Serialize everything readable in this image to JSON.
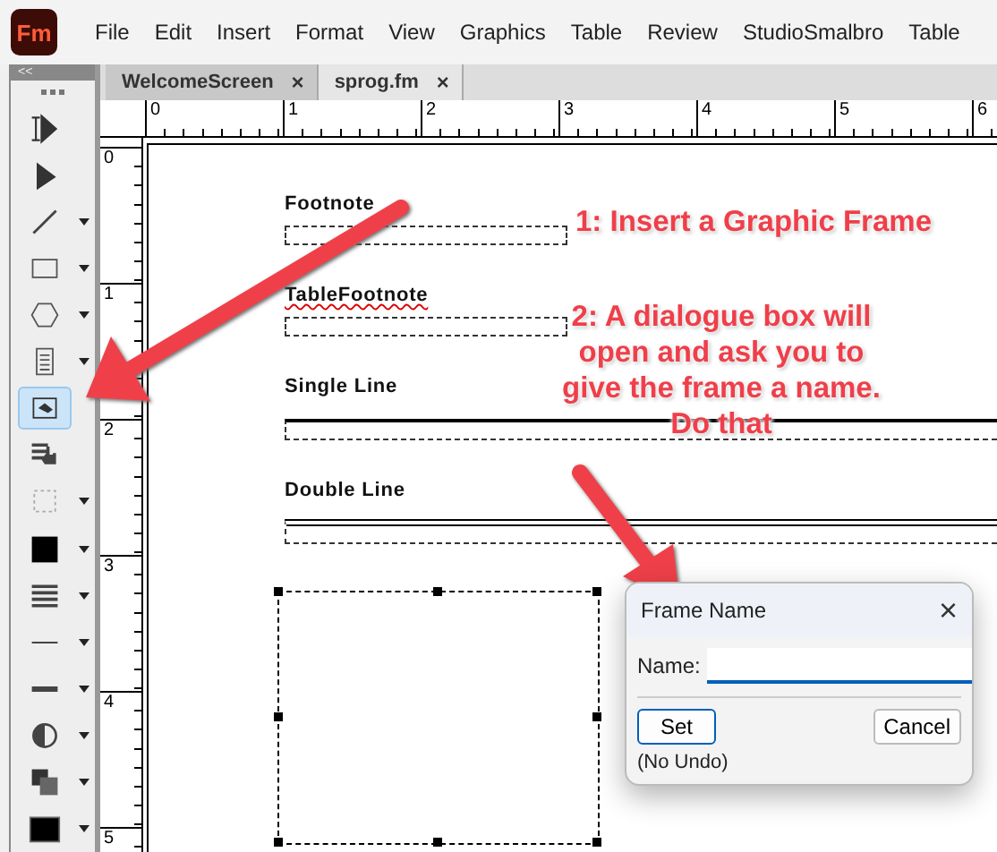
{
  "app": {
    "logo": "Fm"
  },
  "menu": [
    "File",
    "Edit",
    "Insert",
    "Format",
    "View",
    "Graphics",
    "Table",
    "Review",
    "StudioSmalbro",
    "Table"
  ],
  "toolbar": {
    "collapse": "<<",
    "tools": [
      {
        "kind": "text-select",
        "selected": false,
        "dropdown": false
      },
      {
        "kind": "pointer",
        "selected": false,
        "dropdown": false
      },
      {
        "kind": "line",
        "selected": false,
        "dropdown": true
      },
      {
        "kind": "rectangle",
        "selected": false,
        "dropdown": true
      },
      {
        "kind": "polygon",
        "selected": false,
        "dropdown": true
      },
      {
        "kind": "text-frame",
        "selected": false,
        "dropdown": true
      },
      {
        "kind": "graphic-frame",
        "selected": true,
        "dropdown": false
      },
      {
        "kind": "hand",
        "selected": false,
        "dropdown": false
      },
      {
        "kind": "dotted-rect",
        "selected": false,
        "dropdown": true
      },
      {
        "kind": "fill",
        "selected": false,
        "dropdown": true
      },
      {
        "kind": "line-widths",
        "selected": false,
        "dropdown": true
      },
      {
        "kind": "thin-line",
        "selected": false,
        "dropdown": true
      },
      {
        "kind": "thick-line",
        "selected": false,
        "dropdown": true
      },
      {
        "kind": "tint",
        "selected": false,
        "dropdown": true
      },
      {
        "kind": "overlap",
        "selected": false,
        "dropdown": true
      },
      {
        "kind": "color",
        "selected": false,
        "dropdown": true
      }
    ]
  },
  "tabs": [
    {
      "label": "WelcomeScreen",
      "close": "×",
      "selected": false
    },
    {
      "label": "sprog.fm",
      "close": "×",
      "selected": true
    }
  ],
  "ruler": {
    "horizontal": [
      "0",
      "1",
      "2",
      "3",
      "4",
      "5",
      "6"
    ],
    "vertical": [
      "0",
      "1",
      "2",
      "3",
      "4",
      "5"
    ]
  },
  "document": {
    "paragraphs": [
      {
        "label": "Footnote",
        "kind": "short",
        "misspelled": false
      },
      {
        "label": "TableFootnote",
        "kind": "short",
        "misspelled": true
      },
      {
        "label": "Single Line",
        "kind": "single",
        "misspelled": false
      },
      {
        "label": "Double Line",
        "kind": "double",
        "misspelled": false
      }
    ],
    "graphic_frame": {
      "selected": true
    }
  },
  "annotations": [
    "1: Insert a Graphic Frame",
    "2: A dialogue box will open and ask you to give the frame a name. Do that"
  ],
  "dialog": {
    "title": "Frame Name",
    "close": "×",
    "name_label": "Name:",
    "buttons": [
      {
        "label": "Set",
        "default": true
      },
      {
        "label": "Cancel",
        "default": false
      }
    ],
    "note": "(No Undo)"
  }
}
